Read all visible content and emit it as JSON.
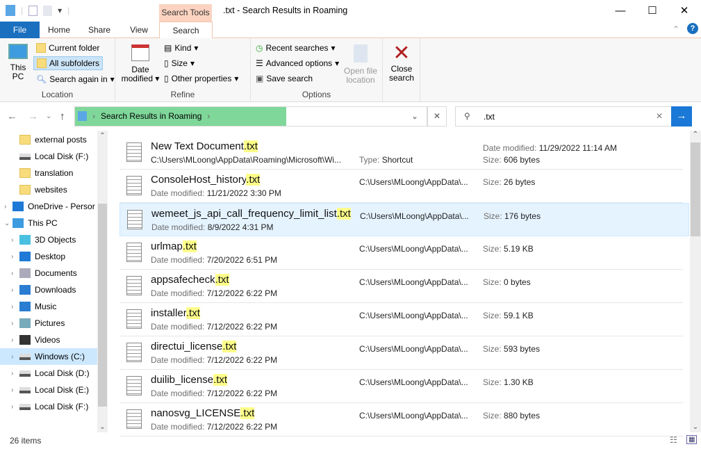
{
  "window": {
    "title": ".txt - Search Results in Roaming",
    "context_tab": "Search Tools"
  },
  "tabs": [
    "File",
    "Home",
    "Share",
    "View",
    "Search"
  ],
  "ribbon": {
    "location": {
      "label": "Location",
      "this_pc": "This PC",
      "current_folder": "Current folder",
      "all_subfolders": "All subfolders",
      "search_again": "Search again in"
    },
    "refine": {
      "label": "Refine",
      "date_modified": "Date modified",
      "kind": "Kind",
      "size": "Size",
      "other": "Other properties"
    },
    "options": {
      "label": "Options",
      "recent": "Recent searches",
      "advanced": "Advanced options",
      "save": "Save search",
      "open_location": "Open file location"
    },
    "close": "Close search"
  },
  "address": {
    "breadcrumb": "Search Results in Roaming",
    "search_value": ".txt"
  },
  "nav": [
    {
      "label": "external posts",
      "icon": "folder",
      "indent": 1
    },
    {
      "label": "Local Disk (F:)",
      "icon": "disk",
      "indent": 1
    },
    {
      "label": "translation",
      "icon": "folder",
      "indent": 1
    },
    {
      "label": "websites",
      "icon": "folder",
      "indent": 1
    },
    {
      "label": "OneDrive - Persor",
      "icon": "cloud",
      "indent": 0,
      "chev": "›"
    },
    {
      "label": "This PC",
      "icon": "pc",
      "indent": 0,
      "chev": "⌄"
    },
    {
      "label": "3D Objects",
      "icon": "cube",
      "indent": 1,
      "chev": "›"
    },
    {
      "label": "Desktop",
      "icon": "desktop",
      "indent": 1,
      "chev": "›"
    },
    {
      "label": "Documents",
      "icon": "doc",
      "indent": 1,
      "chev": "›"
    },
    {
      "label": "Downloads",
      "icon": "download",
      "indent": 1,
      "chev": "›"
    },
    {
      "label": "Music",
      "icon": "music",
      "indent": 1,
      "chev": "›"
    },
    {
      "label": "Pictures",
      "icon": "pictures",
      "indent": 1,
      "chev": "›"
    },
    {
      "label": "Videos",
      "icon": "video",
      "indent": 1,
      "chev": "›"
    },
    {
      "label": "Windows (C:)",
      "icon": "disk-windows",
      "indent": 1,
      "chev": "›",
      "selected": true
    },
    {
      "label": "Local Disk (D:)",
      "icon": "disk",
      "indent": 1,
      "chev": "›"
    },
    {
      "label": "Local Disk (E:)",
      "icon": "disk",
      "indent": 1,
      "chev": "›"
    },
    {
      "label": "Local Disk (F:)",
      "icon": "disk",
      "indent": 1,
      "chev": "›"
    }
  ],
  "files": [
    {
      "name": "New Text Document",
      "ext": ".txt",
      "path": "C:\\Users\\MLoong\\AppData\\Roaming\\Microsoft\\Wi...",
      "type_label": "Type:",
      "type": "Shortcut",
      "date_label": "Date modified:",
      "date": "11/29/2022 11:14 AM",
      "size_label": "Size:",
      "size": "606 bytes"
    },
    {
      "name": "ConsoleHost_history",
      "ext": ".txt",
      "date_label": "Date modified:",
      "date": "11/21/2022 3:30 PM",
      "path": "C:\\Users\\MLoong\\AppData\\...",
      "size_label": "Size:",
      "size": "26 bytes"
    },
    {
      "name": "wemeet_js_api_call_frequency_limit_list",
      "ext": ".txt",
      "date_label": "Date modified:",
      "date": "8/9/2022 4:31 PM",
      "path": "C:\\Users\\MLoong\\AppData\\...",
      "size_label": "Size:",
      "size": "176 bytes",
      "selected": true
    },
    {
      "name": "urlmap",
      "ext": ".txt",
      "date_label": "Date modified:",
      "date": "7/20/2022 6:51 PM",
      "path": "C:\\Users\\MLoong\\AppData\\...",
      "size_label": "Size:",
      "size": "5.19 KB"
    },
    {
      "name": "appsafecheck",
      "ext": ".txt",
      "date_label": "Date modified:",
      "date": "7/12/2022 6:22 PM",
      "path": "C:\\Users\\MLoong\\AppData\\...",
      "size_label": "Size:",
      "size": "0 bytes"
    },
    {
      "name": "installer",
      "ext": ".txt",
      "date_label": "Date modified:",
      "date": "7/12/2022 6:22 PM",
      "path": "C:\\Users\\MLoong\\AppData\\...",
      "size_label": "Size:",
      "size": "59.1 KB"
    },
    {
      "name": "directui_license",
      "ext": ".txt",
      "date_label": "Date modified:",
      "date": "7/12/2022 6:22 PM",
      "path": "C:\\Users\\MLoong\\AppData\\...",
      "size_label": "Size:",
      "size": "593 bytes"
    },
    {
      "name": "duilib_license",
      "ext": ".txt",
      "date_label": "Date modified:",
      "date": "7/12/2022 6:22 PM",
      "path": "C:\\Users\\MLoong\\AppData\\...",
      "size_label": "Size:",
      "size": "1.30 KB"
    },
    {
      "name": "nanosvg_LICENSE",
      "ext": ".txt",
      "date_label": "Date modified:",
      "date": "7/12/2022 6:22 PM",
      "path": "C:\\Users\\MLoong\\AppData\\...",
      "size_label": "Size:",
      "size": "880 bytes"
    }
  ],
  "status": {
    "count": "26 items"
  },
  "colors": {
    "accent": "#1a6fbf",
    "context_tab": "#fbd3c0",
    "match_highlight": "#fdfd8a",
    "selection": "#e5f3ff",
    "address_progress": "#7fd79a"
  }
}
